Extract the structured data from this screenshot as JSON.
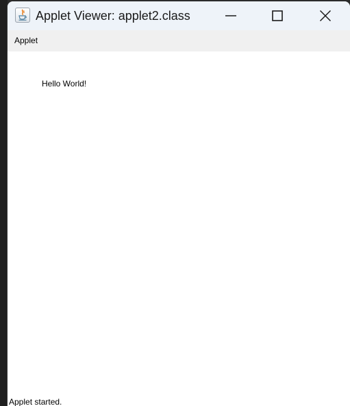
{
  "window": {
    "title": "Applet Viewer: applet2.class",
    "app_icon": "java-cup-icon",
    "controls": {
      "minimize_icon": "minimize-icon",
      "maximize_icon": "maximize-icon",
      "close_icon": "close-icon"
    }
  },
  "menubar": {
    "items": [
      {
        "label": "Applet"
      }
    ]
  },
  "applet": {
    "text": "Hello World!"
  },
  "status": {
    "text": "Applet started."
  },
  "colors": {
    "titlebar": "#eef3f9",
    "menubar": "#f0f0f0",
    "content": "#ffffff",
    "desktop": "#1f1f1f"
  }
}
